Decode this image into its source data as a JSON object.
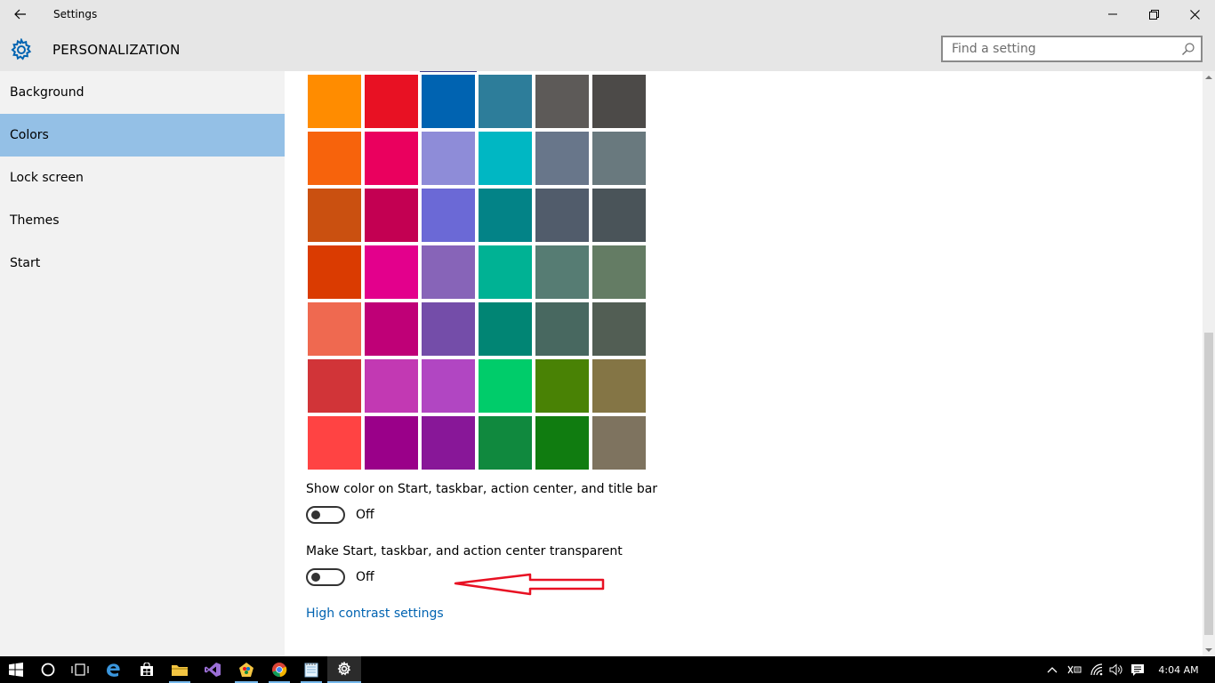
{
  "window": {
    "app_title": "Settings",
    "back_icon": "back-arrow-icon",
    "minimize_icon": "minimize-icon",
    "restore_icon": "restore-icon",
    "close_icon": "close-icon"
  },
  "header": {
    "title": "PERSONALIZATION",
    "icon": "gear-icon",
    "search": {
      "placeholder": "Find a setting",
      "value": ""
    }
  },
  "sidebar": {
    "items": [
      {
        "label": "Background",
        "selected": false
      },
      {
        "label": "Colors",
        "selected": true
      },
      {
        "label": "Lock screen",
        "selected": false
      },
      {
        "label": "Themes",
        "selected": false
      },
      {
        "label": "Start",
        "selected": false
      }
    ],
    "selected_color": "#94c0e6"
  },
  "content": {
    "accent_colors": [
      [
        "#ff8c00",
        "#e81123",
        "#0063b1",
        "#2d7d9a",
        "#5d5a58",
        "#4c4a48"
      ],
      [
        "#f7630c",
        "#ea005e",
        "#8e8cd8",
        "#00b7c3",
        "#68768a",
        "#69797e"
      ],
      [
        "#ca5010",
        "#c30052",
        "#6b69d6",
        "#038387",
        "#515c6b",
        "#4a5459"
      ],
      [
        "#da3b01",
        "#e3008c",
        "#8764b8",
        "#00b294",
        "#567c73",
        "#647c64"
      ],
      [
        "#ef6950",
        "#bf0077",
        "#744da9",
        "#018574",
        "#486860",
        "#525e54"
      ],
      [
        "#d13438",
        "#c239b3",
        "#b146c2",
        "#00cc6a",
        "#498205",
        "#847545"
      ],
      [
        "#ff4343",
        "#9a0089",
        "#881798",
        "#10893e",
        "#107c10",
        "#7e735f"
      ]
    ],
    "show_color_setting": {
      "label": "Show color on Start, taskbar, action center, and title bar",
      "state": "Off"
    },
    "transparency_setting": {
      "label": "Make Start, taskbar, and action center transparent",
      "state": "Off"
    },
    "high_contrast_link": "High contrast settings",
    "annotation_color": "#e81123"
  },
  "taskbar": {
    "items": [
      "windows-start-icon",
      "cortana-circle-icon",
      "task-view-icon",
      "edge-browser-icon",
      "store-icon",
      "file-explorer-icon",
      "visual-studio-icon",
      "paint-app-icon",
      "chrome-icon",
      "notepad-icon",
      "settings-gear-icon"
    ],
    "tray": [
      "chevron-up-icon",
      "keyboard-icon",
      "wifi-icon",
      "volume-icon",
      "action-center-icon"
    ],
    "clock": "4:04 AM"
  }
}
